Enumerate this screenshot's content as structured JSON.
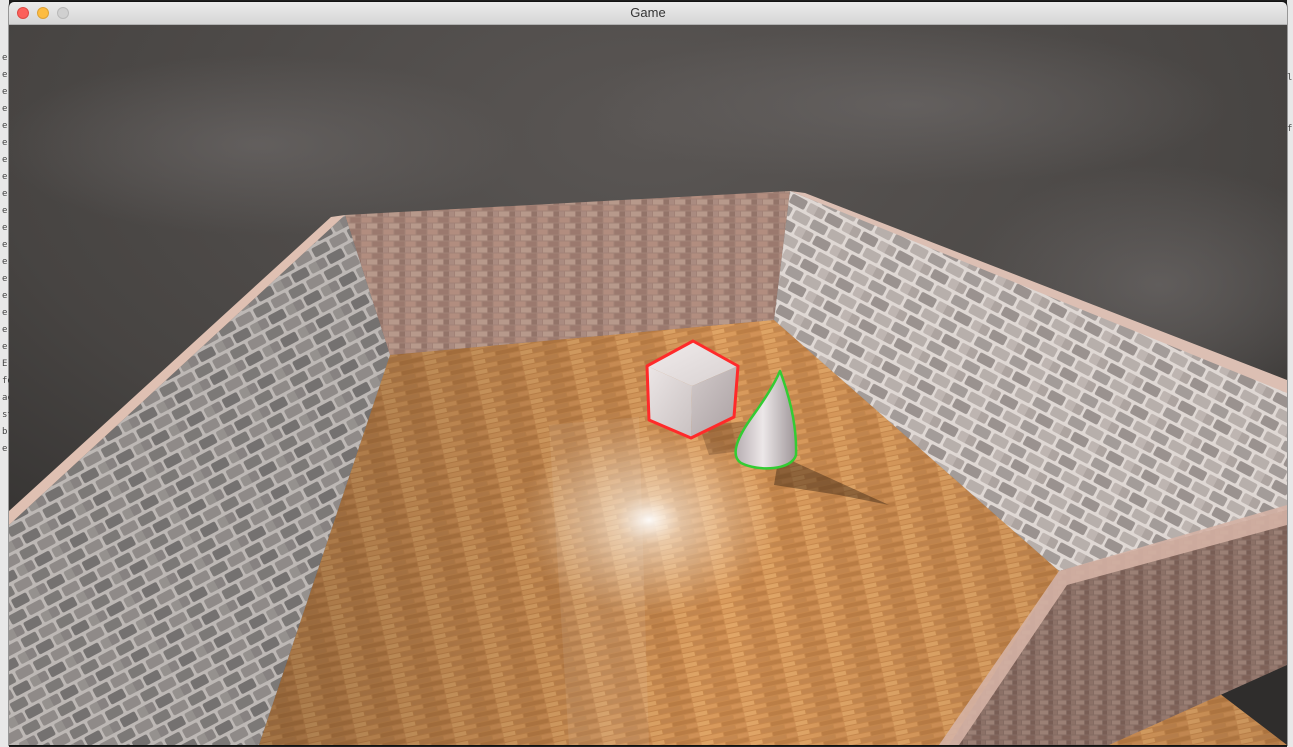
{
  "window": {
    "title": "Game"
  },
  "scene": {
    "objects": [
      {
        "name": "cube",
        "outline_color": "#ff2a2a"
      },
      {
        "name": "cone",
        "outline_color": "#33cc33"
      }
    ],
    "colors": {
      "sky": "#4a4745",
      "floor": "#c98a4e",
      "brick_back": "#a9867a",
      "stone_wall": "#8f8b89",
      "wall_top": "#d9b7a9"
    }
  },
  "background_text": {
    "left": [
      "e",
      "e",
      "e",
      "e",
      "e",
      "e",
      "e",
      "e",
      "e",
      "e",
      "e",
      "e",
      "e",
      "e",
      "e",
      "e",
      "e",
      "e",
      "E",
      "fe",
      "ac",
      "st",
      "b",
      "e"
    ],
    "right": [
      "l",
      "",
      "",
      "f",
      ""
    ]
  }
}
